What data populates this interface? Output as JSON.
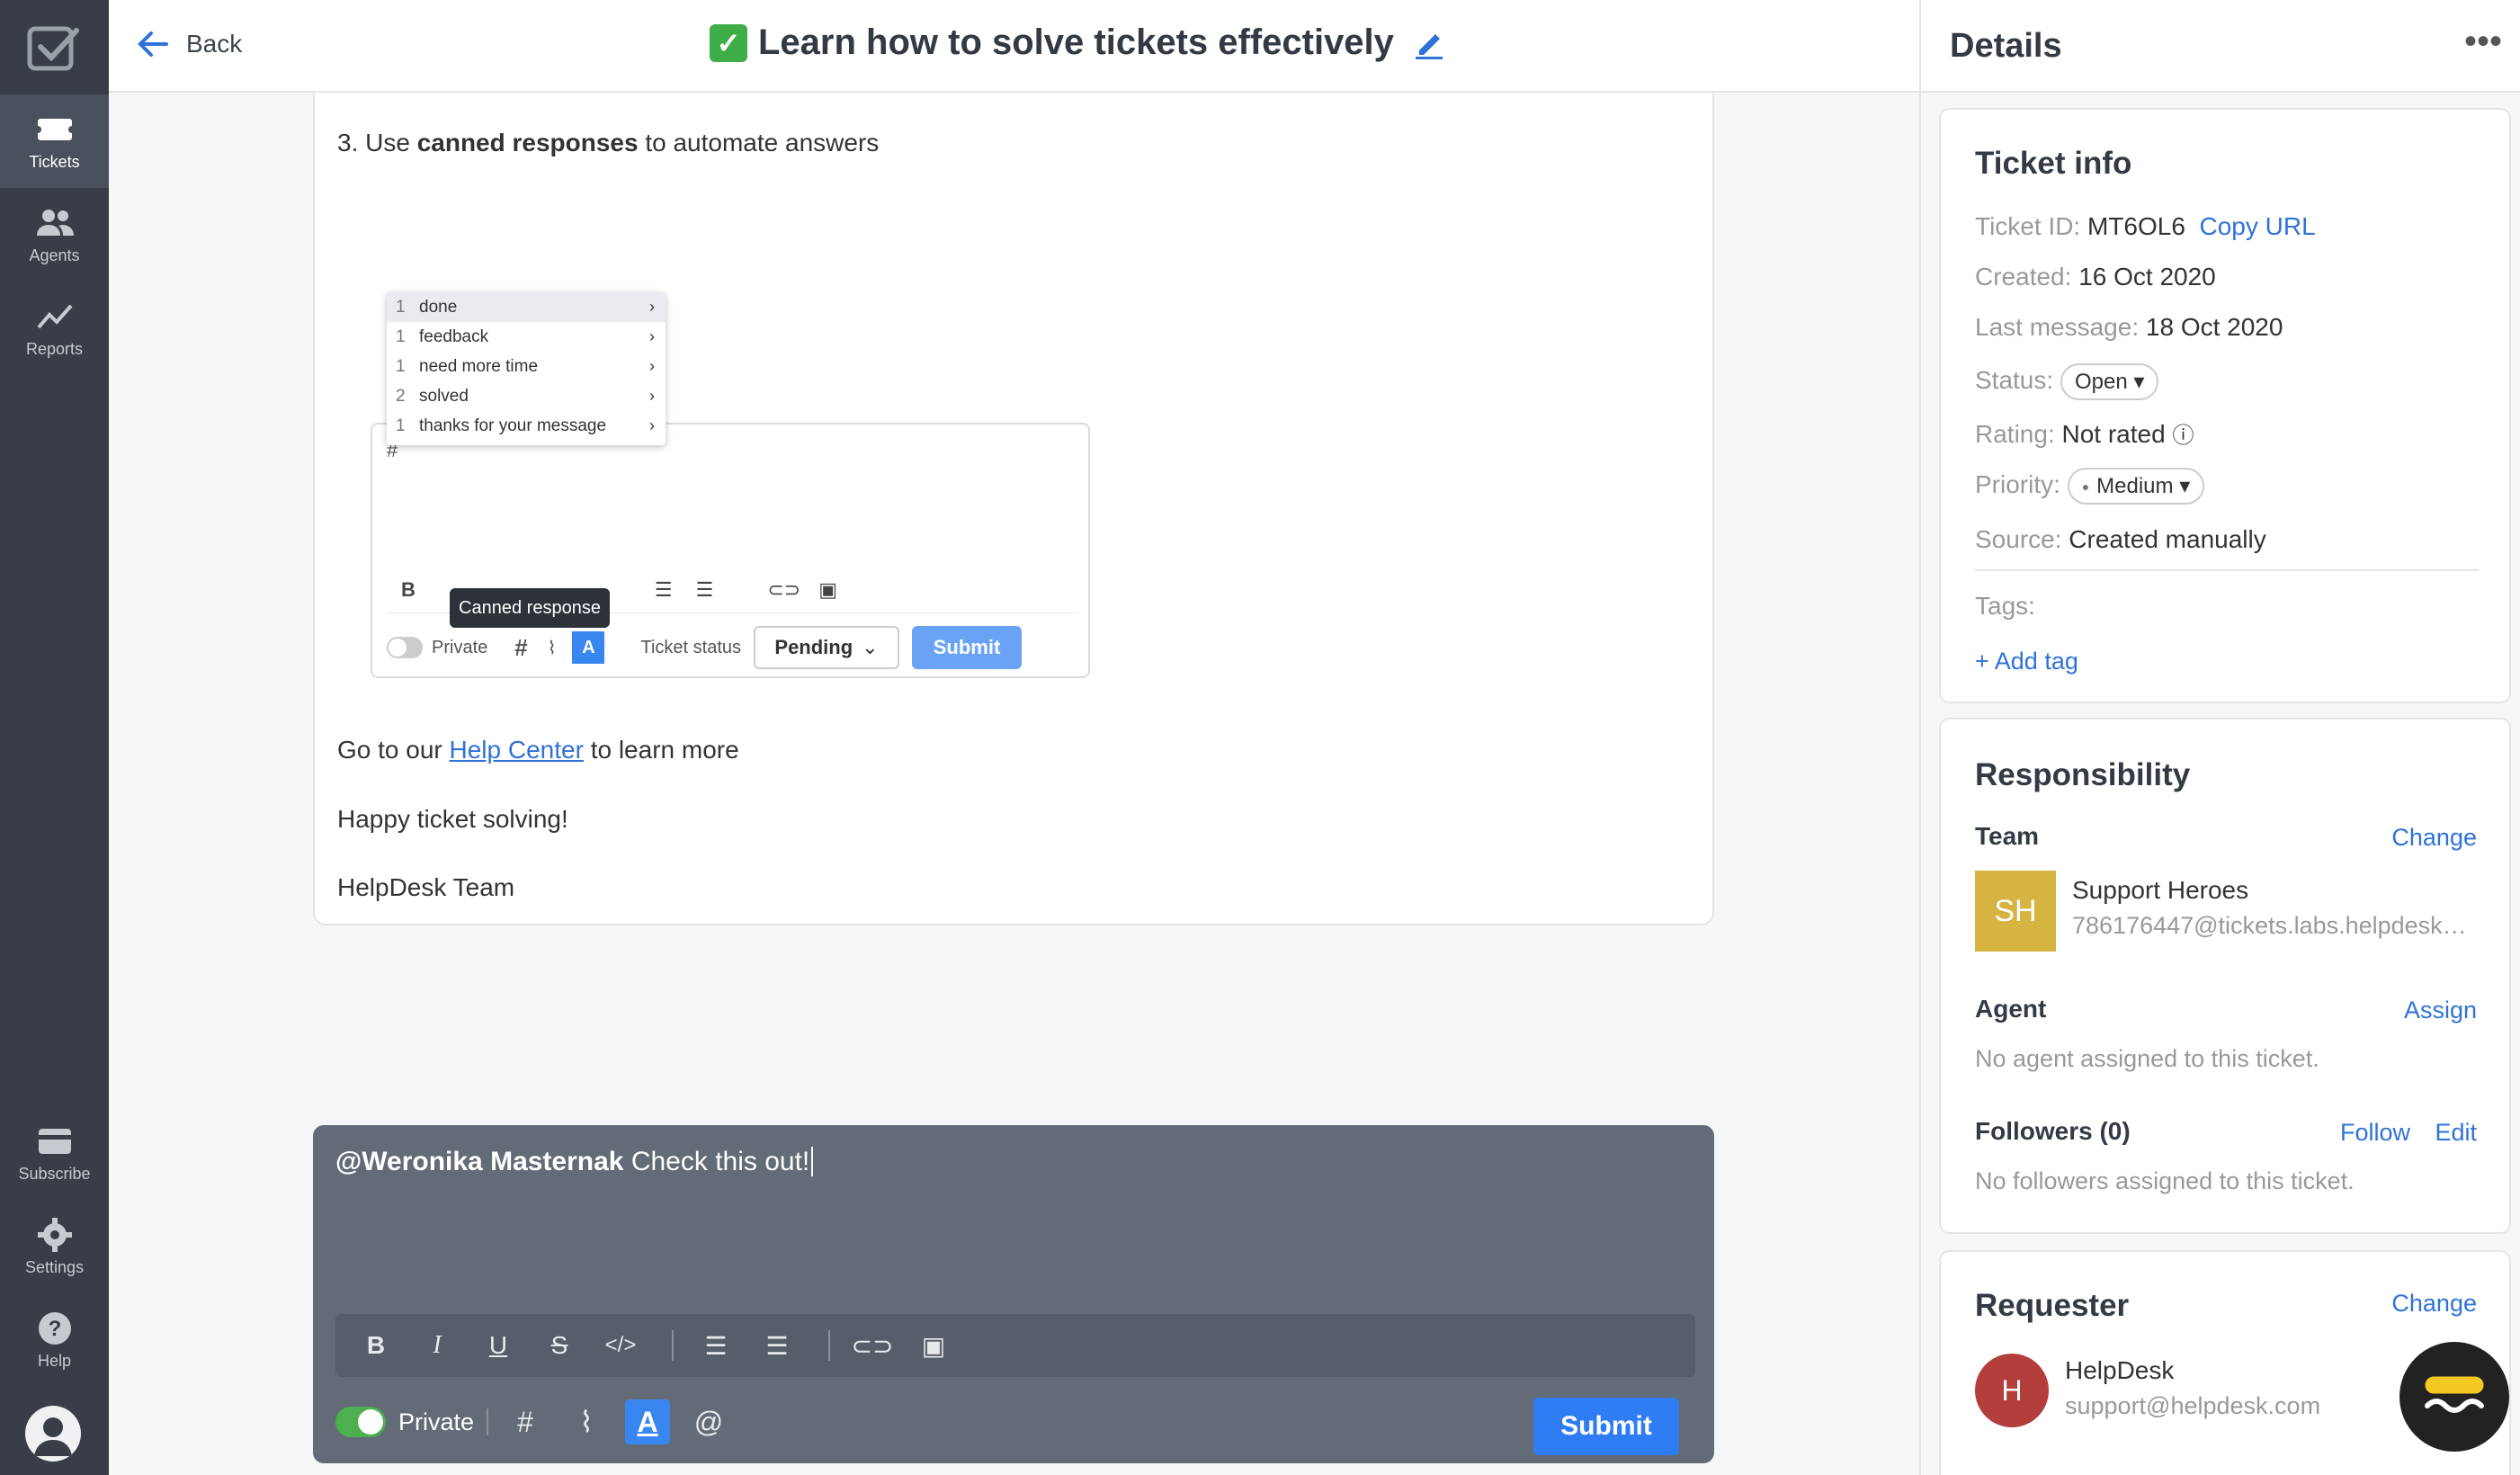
{
  "nav": {
    "items": [
      {
        "label": "Tickets",
        "icon": "ticket-icon",
        "active": true
      },
      {
        "label": "Agents",
        "icon": "agents-icon",
        "active": false
      },
      {
        "label": "Reports",
        "icon": "reports-icon",
        "active": false
      }
    ],
    "bottom": [
      {
        "label": "Subscribe",
        "icon": "subscribe-icon"
      },
      {
        "label": "Settings",
        "icon": "gear-icon"
      },
      {
        "label": "Help",
        "icon": "help-icon"
      }
    ]
  },
  "header": {
    "back_label": "Back",
    "title": "Learn how to solve tickets effectively"
  },
  "message": {
    "step_prefix": "3. Use ",
    "step_bold": "canned responses",
    "step_suffix": " to automate answers",
    "screenshot": {
      "dropdown": [
        {
          "count": "1",
          "label": "done"
        },
        {
          "count": "1",
          "label": "feedback"
        },
        {
          "count": "1",
          "label": "need more time"
        },
        {
          "count": "2",
          "label": "solved"
        },
        {
          "count": "1",
          "label": "thanks for your message"
        }
      ],
      "editor_text": "#",
      "tooltip": "Canned response",
      "private_label": "Private",
      "ticket_status_label": "Ticket status",
      "status_value": "Pending",
      "submit_label": "Submit"
    },
    "help_prefix": "Go to our ",
    "help_link": "Help Center",
    "help_suffix": " to learn more",
    "line_happy": "Happy ticket solving!",
    "signature": "HelpDesk Team"
  },
  "composer": {
    "mention": "@Weronika Masternak",
    "text": " Check this out!",
    "private_label": "Private",
    "submit_label": "Submit"
  },
  "details": {
    "title": "Details",
    "ticket_info": {
      "heading": "Ticket info",
      "ticket_id_label": "Ticket ID:",
      "ticket_id": "MT6OL6",
      "copy_url": "Copy URL",
      "created_label": "Created:",
      "created": "16 Oct 2020",
      "last_message_label": "Last message:",
      "last_message": "18 Oct 2020",
      "status_label": "Status:",
      "status": "Open",
      "rating_label": "Rating:",
      "rating": "Not rated",
      "priority_label": "Priority:",
      "priority": "Medium",
      "source_label": "Source:",
      "source": "Created manually",
      "tags_label": "Tags:",
      "add_tag": "+ Add tag"
    },
    "responsibility": {
      "heading": "Responsibility",
      "team_label": "Team",
      "team_change": "Change",
      "team_initials": "SH",
      "team_name": "Support Heroes",
      "team_email": "786176447@tickets.labs.helpdesk…",
      "agent_label": "Agent",
      "agent_assign": "Assign",
      "agent_empty": "No agent assigned to this ticket.",
      "followers_label": "Followers (0)",
      "follow": "Follow",
      "edit": "Edit",
      "followers_empty": "No followers assigned to this ticket."
    },
    "requester": {
      "heading": "Requester",
      "change": "Change",
      "initial": "H",
      "name": "HelpDesk",
      "email": "support@helpdesk.com"
    }
  },
  "colors": {
    "accent": "#2f7df2",
    "nav_bg": "#383d47",
    "composer_bg": "#636b76",
    "team_badge": "#d5b442",
    "requester_badge": "#b33e3b"
  }
}
